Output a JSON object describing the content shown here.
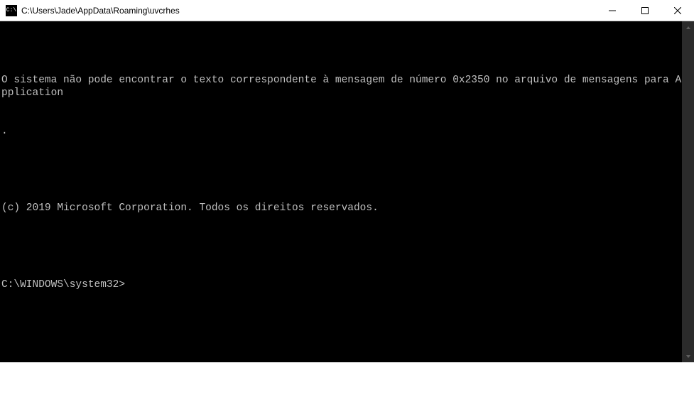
{
  "titlebar": {
    "icon_label": "C:\\",
    "title": "C:\\Users\\Jade\\AppData\\Roaming\\uvcrhes"
  },
  "console": {
    "line1": "O sistema não pode encontrar o texto correspondente à mensagem de número 0x2350 no arquivo de mensagens para Application",
    "line2": ".",
    "line3": "",
    "line4": "(c) 2019 Microsoft Corporation. Todos os direitos reservados.",
    "line5": "",
    "prompt": "C:\\WINDOWS\\system32>"
  }
}
